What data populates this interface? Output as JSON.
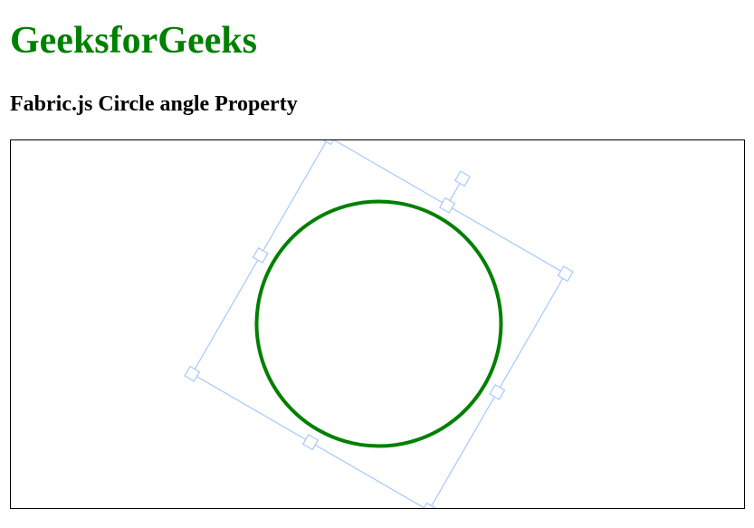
{
  "page": {
    "title": "GeeksforGeeks",
    "heading": "Fabric.js Circle angle Property"
  },
  "circle": {
    "angle": 30,
    "stroke_color": "#008000",
    "fill": "transparent"
  },
  "selection": {
    "border_color": "#a6c8ff",
    "corner_color": "#ffffff"
  },
  "colors": {
    "title": "#008000",
    "heading": "#000000",
    "canvas_border": "#000000"
  }
}
